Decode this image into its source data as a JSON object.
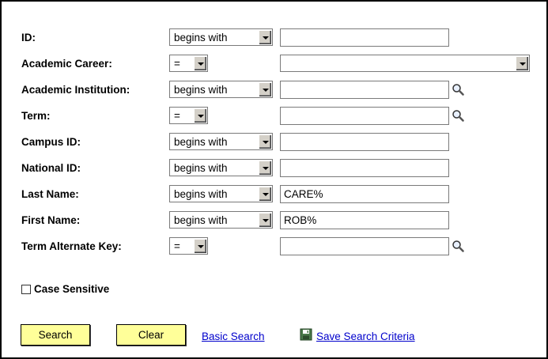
{
  "fields": [
    {
      "label": "ID:",
      "operator": "begins with",
      "value": ""
    },
    {
      "label": "Academic Career:",
      "operator": "=",
      "value": ""
    },
    {
      "label": "Academic Institution:",
      "operator": "begins with",
      "value": ""
    },
    {
      "label": "Term:",
      "operator": "=",
      "value": ""
    },
    {
      "label": "Campus ID:",
      "operator": "begins with",
      "value": ""
    },
    {
      "label": "National ID:",
      "operator": "begins with",
      "value": ""
    },
    {
      "label": "Last Name:",
      "operator": "begins with",
      "value": "CARE%"
    },
    {
      "label": "First Name:",
      "operator": "begins with",
      "value": "ROB%"
    },
    {
      "label": "Term Alternate Key:",
      "operator": "=",
      "value": ""
    }
  ],
  "case_sensitive": {
    "label": "Case Sensitive",
    "checked": false
  },
  "actions": {
    "search": "Search",
    "clear": "Clear",
    "basic_search": "Basic Search",
    "save_search": "Save Search Criteria"
  },
  "icons": {
    "lookup": "magnifier-icon",
    "save": "floppy-disk-icon"
  },
  "colors": {
    "button_bg": "#ffff99",
    "link": "#0000cc"
  }
}
